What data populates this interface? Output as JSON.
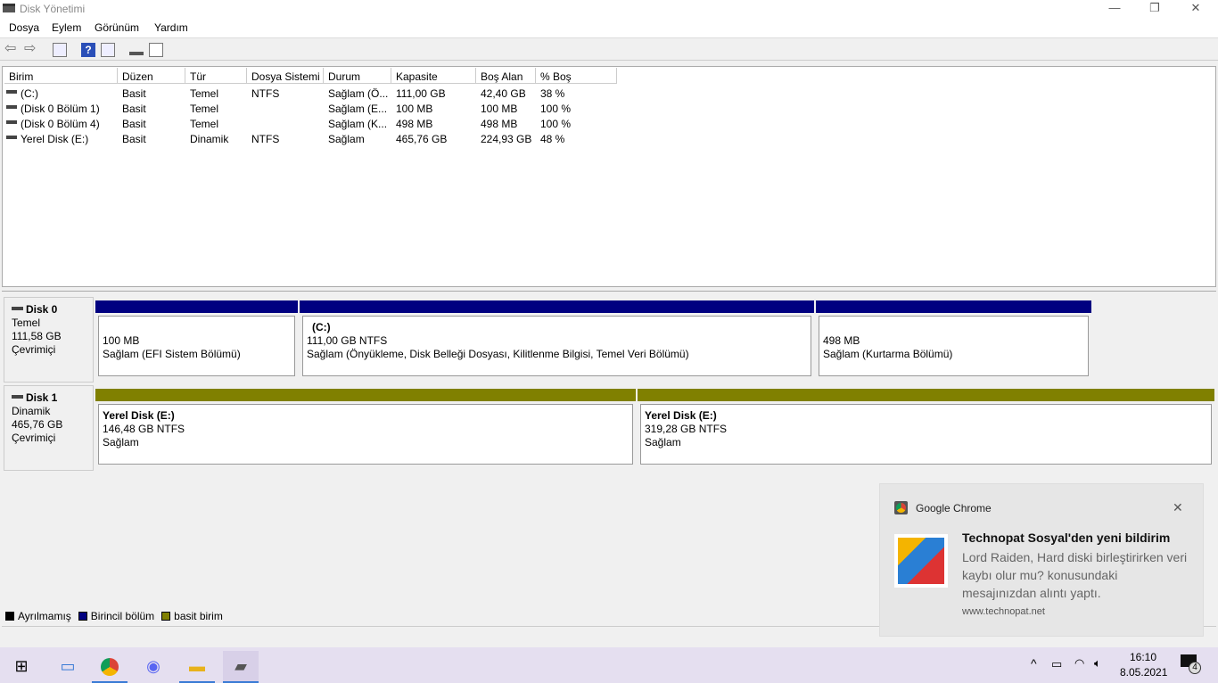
{
  "window": {
    "title": "Disk Yönetimi",
    "minimize": "—",
    "maximize": "❐",
    "close": "✕"
  },
  "menu": [
    "Dosya",
    "Eylem",
    "Görünüm",
    "Yardım"
  ],
  "toolbar_icons": [
    "back-icon",
    "forward-icon",
    "console-tree-icon",
    "help-icon",
    "action-pane-icon",
    "connect-icon",
    "properties-icon"
  ],
  "table": {
    "columns": [
      "Birim",
      "Düzen",
      "Tür",
      "Dosya Sistemi",
      "Durum",
      "Kapasite",
      "Boş Alan",
      "% Boş"
    ],
    "rows": [
      [
        "(C:)",
        "Basit",
        "Temel",
        "NTFS",
        "Sağlam (Ö...",
        "111,00 GB",
        "42,40 GB",
        "38 %"
      ],
      [
        "(Disk 0 Bölüm 1)",
        "Basit",
        "Temel",
        "",
        "Sağlam (E...",
        "100 MB",
        "100 MB",
        "100 %"
      ],
      [
        "(Disk 0 Bölüm 4)",
        "Basit",
        "Temel",
        "",
        "Sağlam (K...",
        "498 MB",
        "498 MB",
        "100 %"
      ],
      [
        "Yerel Disk (E:)",
        "Basit",
        "Dinamik",
        "NTFS",
        "Sağlam",
        "465,76 GB",
        "224,93 GB",
        "48 %"
      ]
    ]
  },
  "disks": [
    {
      "name": "Disk 0",
      "type": "Temel",
      "size": "111,58 GB",
      "status": "Çevrimiçi",
      "partitions": [
        {
          "title": "",
          "size": "100 MB",
          "status": "Sağlam (EFI Sistem Bölümü)",
          "color": "#000080"
        },
        {
          "title": "(C:)",
          "size": "111,00 GB NTFS",
          "status": "Sağlam (Önyükleme, Disk Belleği Dosyası, Kilitlenme Bilgisi, Temel Veri Bölümü)",
          "color": "#000080"
        },
        {
          "title": "",
          "size": "498 MB",
          "status": "Sağlam (Kurtarma Bölümü)",
          "color": "#000080"
        }
      ]
    },
    {
      "name": "Disk 1",
      "type": "Dinamik",
      "size": "465,76 GB",
      "status": "Çevrimiçi",
      "partitions": [
        {
          "title": "Yerel Disk  (E:)",
          "size": "146,48 GB NTFS",
          "status": "Sağlam",
          "color": "#808000"
        },
        {
          "title": "Yerel Disk  (E:)",
          "size": "319,28 GB NTFS",
          "status": "Sağlam",
          "color": "#808000"
        }
      ]
    }
  ],
  "legend": [
    {
      "label": "Ayrılmamış",
      "color": "#000000"
    },
    {
      "label": "Birincil bölüm",
      "color": "#000080"
    },
    {
      "label": "basit birim",
      "color": "#808000"
    }
  ],
  "notification": {
    "app": "Google Chrome",
    "title": "Technopat Sosyal'den yeni bildirim",
    "body": "Lord Raiden, Hard diski birleştirirken veri kaybı olur mu? konusundaki mesajınızdan alıntı yaptı.",
    "source": "www.technopat.net",
    "close": "✕"
  },
  "taskbar": {
    "time": "16:10",
    "date": "8.05.2021",
    "notification_count": "4"
  }
}
